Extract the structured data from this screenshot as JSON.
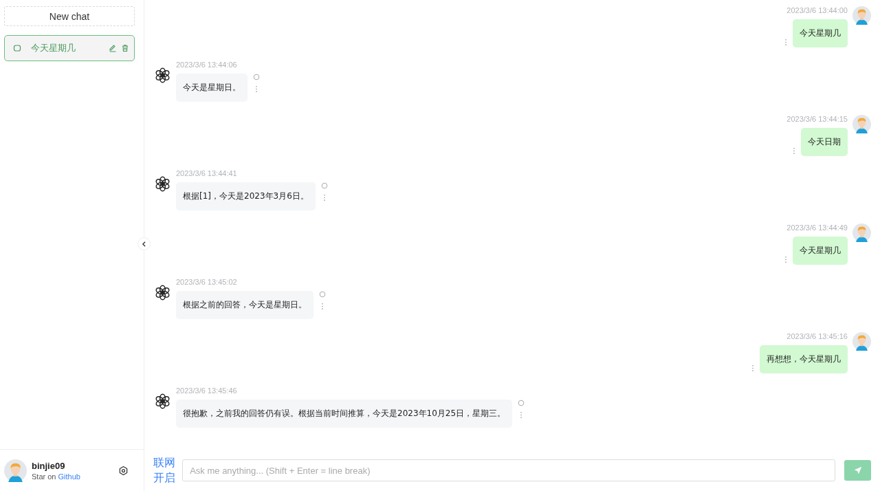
{
  "sidebar": {
    "new_chat": "New chat",
    "conversations": [
      {
        "title": "今天星期几",
        "selected": true
      }
    ],
    "user": {
      "name": "binjie09",
      "subtitle": "Star on ",
      "link": "Github"
    }
  },
  "messages": [
    {
      "kind": "user",
      "time": "2023/3/6 13:44:00",
      "text": "今天星期几"
    },
    {
      "kind": "assistant",
      "time": "2023/3/6 13:44:06",
      "text": "今天是星期日。"
    },
    {
      "kind": "user",
      "time": "2023/3/6 13:44:15",
      "text": "今天日期"
    },
    {
      "kind": "assistant",
      "time": "2023/3/6 13:44:41",
      "text": "根据[1]，今天是2023年3月6日。"
    },
    {
      "kind": "user",
      "time": "2023/3/6 13:44:49",
      "text": "今天星期几"
    },
    {
      "kind": "assistant",
      "time": "2023/3/6 13:45:02",
      "text": "根据之前的回答，今天是星期日。"
    },
    {
      "kind": "user",
      "time": "2023/3/6 13:45:16",
      "text": "再想想，今天星期几"
    },
    {
      "kind": "assistant",
      "time": "2023/3/6 13:45:46",
      "text": "很抱歉，之前我的回答仍有误。根据当前时间推算，今天是2023年10月25日，星期三。"
    }
  ],
  "composer": {
    "web_toggle": "联网开启",
    "placeholder": "Ask me anything... (Shift + Enter = line break)"
  }
}
